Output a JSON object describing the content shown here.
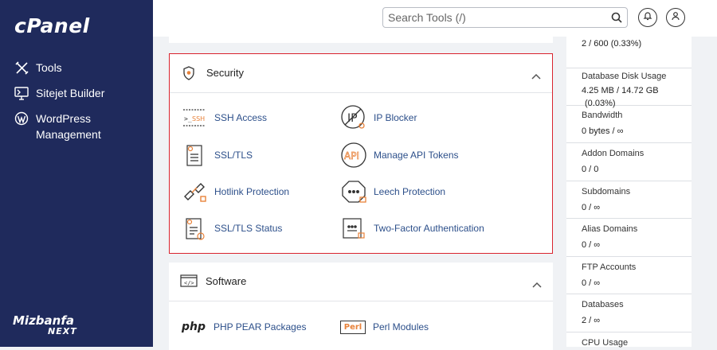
{
  "app": {
    "logo": "cPanel"
  },
  "sidebar": {
    "items": [
      {
        "label": "Tools",
        "icon": "tools-icon"
      },
      {
        "label": "Sitejet Builder",
        "icon": "sitejet-icon"
      },
      {
        "label": "WordPress Management",
        "icon": "wordpress-icon"
      }
    ],
    "brand": {
      "line1": "Mizbanfa",
      "line2": "NEXT"
    }
  },
  "header": {
    "search_placeholder": "Search Tools (/)",
    "search_icon": "search-icon",
    "notifications_icon": "bell-icon",
    "user_icon": "user-icon"
  },
  "security": {
    "title": "Security",
    "tools": [
      {
        "label": "SSH Access",
        "icon": "ssh-icon"
      },
      {
        "label": "IP Blocker",
        "icon": "ip-blocker-icon"
      },
      {
        "label": "SSL/TLS",
        "icon": "ssl-certificate-icon"
      },
      {
        "label": "Manage API Tokens",
        "icon": "api-icon"
      },
      {
        "label": "Hotlink Protection",
        "icon": "broken-link-icon"
      },
      {
        "label": "Leech Protection",
        "icon": "leech-protection-icon"
      },
      {
        "label": "SSL/TLS Status",
        "icon": "ssl-status-icon"
      },
      {
        "label": "Two-Factor Authentication",
        "icon": "two-factor-icon"
      }
    ]
  },
  "software": {
    "title": "Software",
    "tools": [
      {
        "label": "PHP PEAR Packages",
        "icon": "php-icon",
        "icon_text": "php"
      },
      {
        "label": "Perl Modules",
        "icon": "perl-icon",
        "icon_text": "Perl"
      }
    ]
  },
  "stats": [
    {
      "label": "",
      "value": "2 / 600   (0.33%)"
    },
    {
      "label": "Database Disk Usage",
      "value": "4.25 MB / 14.72 GB",
      "value2": "(0.03%)"
    },
    {
      "label": "Bandwidth",
      "value": "0 bytes / ∞"
    },
    {
      "label": "Addon Domains",
      "value": "0 / 0"
    },
    {
      "label": "Subdomains",
      "value": "0 / ∞"
    },
    {
      "label": "Alias Domains",
      "value": "0 / ∞"
    },
    {
      "label": "FTP Accounts",
      "value": "0 / ∞"
    },
    {
      "label": "Databases",
      "value": "2 / ∞"
    },
    {
      "label": "CPU Usage",
      "value": ""
    }
  ],
  "colors": {
    "sidebar": "#1f2a5c",
    "accent_orange": "#e8823a",
    "link_blue": "#2c4f8a",
    "highlight_border": "#d9232e"
  }
}
